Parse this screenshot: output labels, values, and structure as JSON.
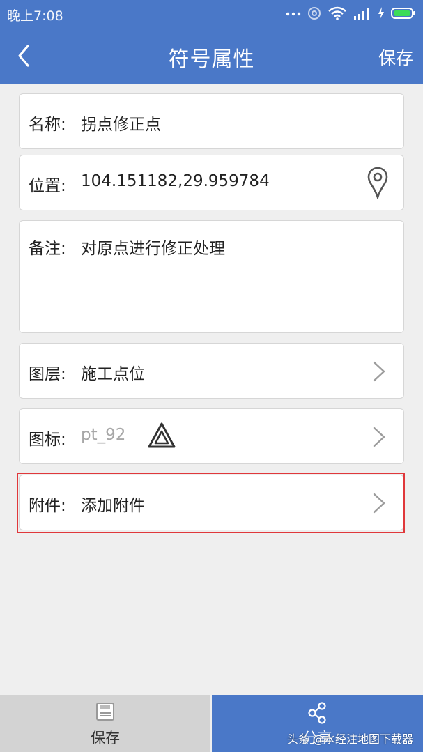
{
  "status_bar": {
    "time": "晚上7:08",
    "icons": [
      "more-dots-icon",
      "alarm-icon",
      "wifi-icon",
      "signal-icon",
      "charging-icon",
      "battery-icon"
    ]
  },
  "app_bar": {
    "title": "符号属性",
    "save_label": "保存"
  },
  "fields": {
    "name": {
      "label": "名称:",
      "value": "拐点修正点"
    },
    "location": {
      "label": "位置:",
      "value": "104.151182,29.959784"
    },
    "note": {
      "label": "备注:",
      "value": "对原点进行修正处理"
    },
    "layer": {
      "label": "图层:",
      "value": "施工点位"
    },
    "icon": {
      "label": "图标:",
      "value": "pt_92"
    },
    "attachment": {
      "label": "附件:",
      "value": "添加附件"
    }
  },
  "bottom_bar": {
    "save_label": "保存",
    "share_label": "分享",
    "watermark": "头条 @水经注地图下载器"
  },
  "colors": {
    "primary": "#4a78c8",
    "background": "#efefef",
    "highlight_border": "#e0383b",
    "save_tab_bg": "#d3d3d3"
  }
}
